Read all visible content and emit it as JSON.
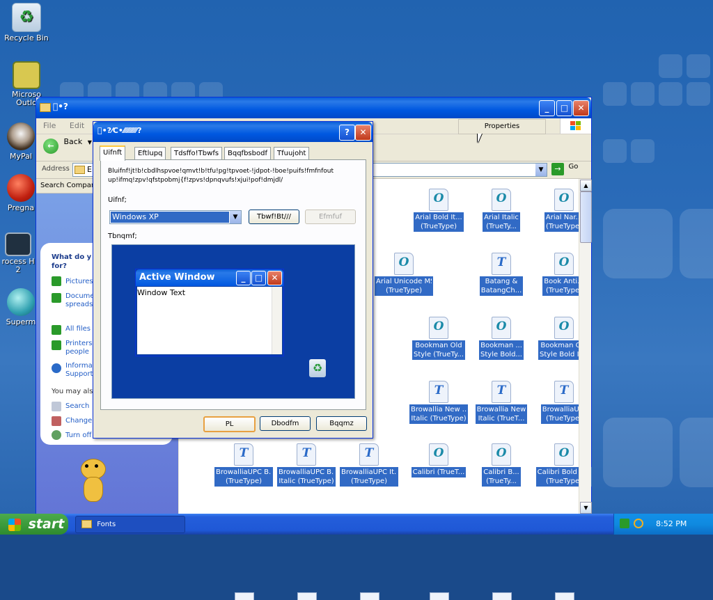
{
  "desktop": {
    "icons": [
      {
        "label": "Recycle Bin",
        "icon": "recycle-bin-icon"
      },
      {
        "label": "Microso\nOutlo",
        "icon": "outlook-icon"
      },
      {
        "label": "MyPal",
        "icon": "mypal-icon"
      },
      {
        "label": "Pregna",
        "icon": "app-icon"
      },
      {
        "label": "rocess H\n2",
        "icon": "process-icon"
      },
      {
        "label": "Superm",
        "icon": "app-icon"
      }
    ]
  },
  "explorer": {
    "title": "\u0000•?",
    "menu": [
      "File",
      "Edit"
    ],
    "back_label": "Back",
    "address_label": "Address",
    "address_value": "E",
    "go_label": "Go",
    "search_companion": "Search Compan",
    "properties_label": "Properties",
    "assistant": {
      "heading": "What do y\nfor?",
      "links": [
        {
          "text": "Pictures",
          "icon": "arrow-icon"
        },
        {
          "text": "Docume\nspreadsh",
          "icon": "arrow-icon"
        },
        {
          "text": "All files a",
          "icon": "arrow-icon"
        },
        {
          "text": "Printers\npeople",
          "icon": "arrow-icon"
        },
        {
          "text": "Informat\nSupport",
          "icon": "help-icon"
        }
      ],
      "also_label": "You may also",
      "also_links": [
        {
          "text": "Search",
          "icon": "search-icon"
        },
        {
          "text": "Change",
          "icon": "change-icon"
        },
        {
          "text": "Turn off",
          "icon": "turn-off-icon"
        }
      ]
    },
    "files": [
      {
        "line1": "Arial Bold It...",
        "line2": "(TrueType)",
        "glyph": "O"
      },
      {
        "line1": "Arial Italic",
        "line2": "(TrueTy...",
        "glyph": "O"
      },
      {
        "line1": "Arial Nar...",
        "line2": "(TrueType)",
        "glyph": "O"
      },
      {
        "line1": "Arial Unicode MS",
        "line2": "(TrueType)",
        "glyph": "O"
      },
      {
        "line1": "Batang &",
        "line2": "BatangCh...",
        "glyph": "T"
      },
      {
        "line1": "Book Anti...",
        "line2": "(TrueType)",
        "glyph": "O"
      },
      {
        "line1": "Bookman Old",
        "line2": "Style (TrueTy...",
        "glyph": "O"
      },
      {
        "line1": "Bookman ...",
        "line2": "Style Bold...",
        "glyph": "O"
      },
      {
        "line1": "Bookman Old",
        "line2": "Style Bold It...",
        "glyph": "O"
      },
      {
        "line1": "Browallia New ...",
        "line2": "Italic (TrueType)",
        "glyph": "T"
      },
      {
        "line1": "Browallia New",
        "line2": "Italic (TrueT...",
        "glyph": "T"
      },
      {
        "line1": "BrowalliaU...",
        "line2": "(TrueType)",
        "glyph": "T"
      },
      {
        "line1": "BrowalliaUPC B...",
        "line2": "(TrueType)",
        "glyph": "T"
      },
      {
        "line1": "BrowalliaUPC B...",
        "line2": "Italic (TrueType)",
        "glyph": "T"
      },
      {
        "line1": "BrowalliaUPC It...",
        "line2": "(TrueType)",
        "glyph": "T"
      },
      {
        "line1": "Calibri (TrueT...",
        "line2": "",
        "glyph": "O"
      },
      {
        "line1": "Calibri B...",
        "line2": "(TrueTy...",
        "glyph": "O"
      },
      {
        "line1": "Calibri Bold It...",
        "line2": "(TrueType)",
        "glyph": "O"
      }
    ]
  },
  "dialog": {
    "title": "\u0000•?⁄C•⁄⁄⁄⁄⁄⁄⁄⁄⁄⁄⁄?",
    "tabs": [
      "Uifnft",
      "Eftlupq",
      "Tdsffo!Tbwfs",
      "Bqqfbsbodf",
      "Tfuujoht"
    ],
    "description": "Bluifnf!jt!b!cbdlhspvoe!qmvt!b!tfu!pg!tpvoet-!jdpot-!boe!puifs!fmfnfout\nup!ifmq!zpv!qfstpobmj{f!zpvs!dpnqvufs!xjui!pof!dmjdl/",
    "theme_label": "Uifnf;",
    "theme_value": "Windows XP",
    "save_as_label": "Tbwf!Bt///",
    "delete_label": "Efmfuf",
    "sample_label": "Tbnqmf;",
    "preview": {
      "window_title": "Active Window",
      "window_text": "Window Text"
    },
    "ok_label": "PL",
    "cancel_label": "Dbodfm",
    "apply_label": "Bqqmz"
  },
  "taskbar": {
    "start_label": "start",
    "task_label": "Fonts",
    "clock": "8:52 PM"
  },
  "colors": {
    "title_blue": "#0058e0",
    "selection_blue": "#316ac5",
    "desktop_blue": "#2a6bb8",
    "start_green": "#3c9c3c"
  }
}
